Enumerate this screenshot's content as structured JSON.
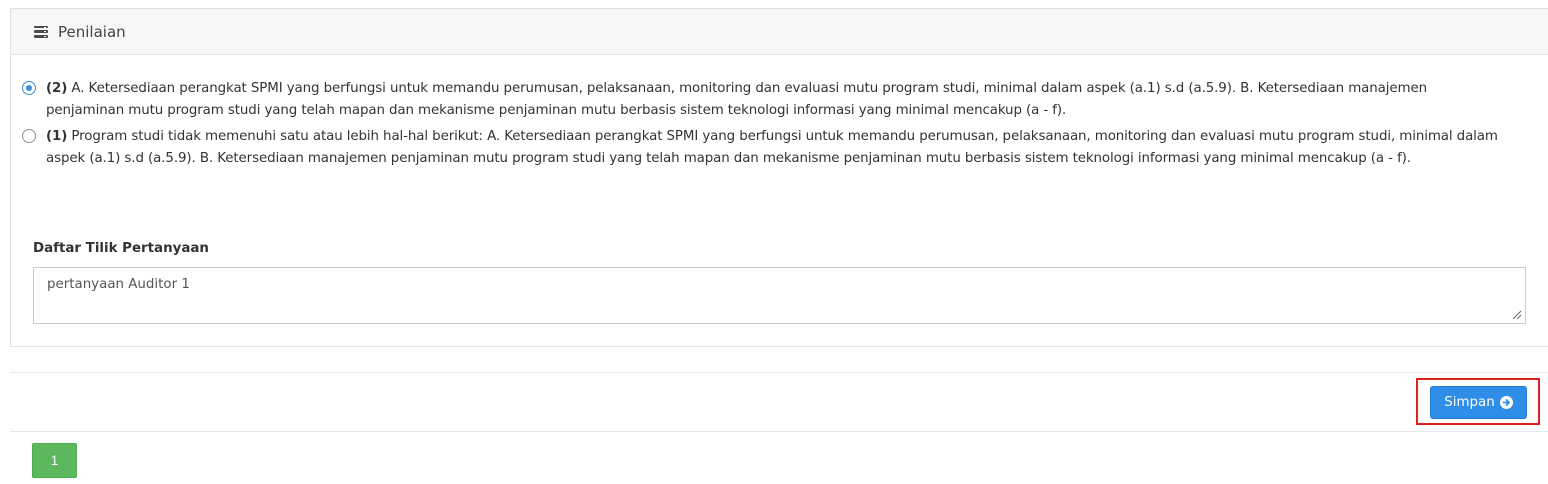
{
  "panel": {
    "title": "Penilaian",
    "icon": "server-list-icon"
  },
  "options": [
    {
      "score": "(2)",
      "text": " A. Ketersediaan perangkat SPMI yang berfungsi untuk memandu perumusan, pelaksanaan, monitoring dan evaluasi mutu program studi, minimal dalam aspek (a.1) s.d (a.5.9). B. Ketersediaan manajemen penjaminan mutu program studi yang telah mapan dan mekanisme penjaminan mutu berbasis sistem teknologi informasi yang minimal mencakup (a - f).",
      "checked": true
    },
    {
      "score": "(1)",
      "text": " Program studi tidak memenuhi satu atau lebih hal-hal berikut: A. Ketersediaan perangkat SPMI yang berfungsi untuk memandu perumusan, pelaksanaan, monitoring dan evaluasi mutu program studi, minimal dalam aspek (a.1) s.d (a.5.9). B. Ketersediaan manajemen penjaminan mutu program studi yang telah mapan dan mekanisme penjaminan mutu berbasis sistem teknologi informasi yang minimal mencakup (a - f).",
      "checked": false
    }
  ],
  "checklist": {
    "label": "Daftar Tilik Pertanyaan",
    "value": "pertanyaan Auditor 1"
  },
  "actions": {
    "save_label": "Simpan",
    "save_icon": "arrow-circle-right-icon",
    "highlight_color": "#e01f1f"
  },
  "pagination": {
    "current_page": "1"
  },
  "colors": {
    "primary": "#2e8ee8",
    "success": "#5cb85c",
    "radio_checked": "#3b8ed9"
  }
}
